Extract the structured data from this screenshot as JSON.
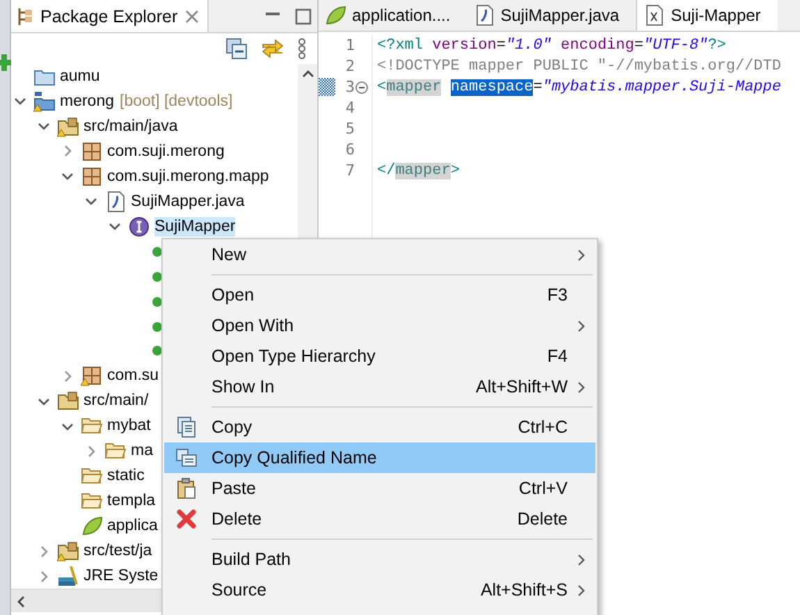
{
  "explorer": {
    "title": "Package Explorer",
    "tree": [
      {
        "label": "aumu",
        "kind": "folder",
        "selected": false
      },
      {
        "label": "merong",
        "decoration": "[boot] [devtools]",
        "kind": "project",
        "expanded": true,
        "selected": false,
        "children": [
          {
            "label": "src/main/java",
            "kind": "source",
            "expanded": true,
            "selected": false,
            "children": [
              {
                "label": "com.suji.merong",
                "kind": "package",
                "expanded": false,
                "selected": false
              },
              {
                "label": "com.suji.merong.mapp",
                "kind": "package",
                "expanded": true,
                "selected": false,
                "children": [
                  {
                    "label": "SujiMapper.java",
                    "kind": "java",
                    "expanded": true,
                    "selected": false,
                    "children": [
                      {
                        "label": "SujiMapper",
                        "kind": "interface",
                        "expanded": true,
                        "selected": true,
                        "children": [
                          {
                            "kind": "method"
                          },
                          {
                            "kind": "method"
                          },
                          {
                            "kind": "method"
                          },
                          {
                            "kind": "method"
                          },
                          {
                            "kind": "method"
                          }
                        ]
                      }
                    ]
                  }
                ]
              },
              {
                "label": "com.su",
                "kind": "package-warning",
                "expanded": false,
                "selected": false
              }
            ]
          },
          {
            "label": "src/main/",
            "kind": "source-folder",
            "expanded": true,
            "selected": false,
            "children": [
              {
                "label": "mybat",
                "kind": "folder-open",
                "expanded": true,
                "selected": false,
                "children": [
                  {
                    "label": "ma",
                    "kind": "folder-open",
                    "expanded": false,
                    "selected": false
                  }
                ]
              },
              {
                "label": "static",
                "kind": "folder-open",
                "selected": false
              },
              {
                "label": "templa",
                "kind": "folder-open",
                "selected": false
              },
              {
                "label": "applica",
                "kind": "spring",
                "selected": false
              }
            ]
          },
          {
            "label": "src/test/ja",
            "kind": "source",
            "expanded": false,
            "selected": false
          },
          {
            "label": "JRE Syste",
            "kind": "library",
            "expanded": false,
            "selected": false
          }
        ]
      }
    ]
  },
  "editor": {
    "tabs": [
      {
        "label": "application....",
        "kind": "spring",
        "selected": false
      },
      {
        "label": "SujiMapper.java",
        "kind": "java",
        "selected": false
      },
      {
        "label": "Suji-Mapper",
        "kind": "xml",
        "selected": true
      }
    ],
    "lines": [
      {
        "number": "1",
        "tokens": [
          {
            "kind": "tag",
            "text": "<?xml"
          },
          {
            "kind": "attr",
            "text": "version"
          },
          {
            "kind": "text",
            "text": "="
          },
          {
            "kind": "string",
            "text": "\"1.0\""
          },
          {
            "kind": "attr",
            "text": "encoding"
          },
          {
            "kind": "text",
            "text": "="
          },
          {
            "kind": "string",
            "text": "\"UTF-8\""
          },
          {
            "kind": "tag",
            "text": "?>"
          }
        ]
      },
      {
        "number": "2",
        "tokens": [
          {
            "kind": "doctype",
            "text": "<!DOCTYPE mapper PUBLIC \"-//mybatis.org//DTD"
          }
        ]
      },
      {
        "number": "3",
        "folded": false,
        "current": true,
        "tokens": [
          {
            "kind": "tag",
            "text": "<"
          },
          {
            "kind": "tag-marked",
            "text": "mapper"
          },
          {
            "kind": "attr-selected",
            "text": "namespace"
          },
          {
            "kind": "text",
            "text": "="
          },
          {
            "kind": "string",
            "text": "\"mybatis.mapper.Suji-Mappe"
          }
        ]
      },
      {
        "number": "4"
      },
      {
        "number": "5"
      },
      {
        "number": "6"
      },
      {
        "number": "7",
        "tokens": [
          {
            "kind": "tag",
            "text": "</"
          },
          {
            "kind": "tag-marked",
            "text": "mapper"
          },
          {
            "kind": "tag",
            "text": ">"
          }
        ]
      }
    ]
  },
  "context_menu": [
    {
      "kind": "item",
      "label": "New",
      "submenu": true,
      "selected": false
    },
    {
      "kind": "separator"
    },
    {
      "kind": "item",
      "label": "Open",
      "shortcut": "F3",
      "selected": false
    },
    {
      "kind": "item",
      "label": "Open With",
      "submenu": true,
      "selected": false
    },
    {
      "kind": "item",
      "label": "Open Type Hierarchy",
      "shortcut": "F4",
      "selected": false
    },
    {
      "kind": "item",
      "label": "Show In",
      "shortcut": "Alt+Shift+W",
      "submenu": true,
      "selected": false
    },
    {
      "kind": "separator"
    },
    {
      "kind": "item",
      "label": "Copy",
      "shortcut": "Ctrl+C",
      "selected": false
    },
    {
      "kind": "item",
      "label": "Copy Qualified Name",
      "selected": true
    },
    {
      "kind": "item",
      "label": "Paste",
      "shortcut": "Ctrl+V",
      "selected": false
    },
    {
      "kind": "item",
      "label": "Delete",
      "shortcut": "Delete",
      "selected": false
    },
    {
      "kind": "separator"
    },
    {
      "kind": "item",
      "label": "Build Path",
      "submenu": true,
      "selected": false
    },
    {
      "kind": "item",
      "label": "Source",
      "shortcut": "Alt+Shift+S",
      "submenu": true,
      "selected": false
    }
  ]
}
